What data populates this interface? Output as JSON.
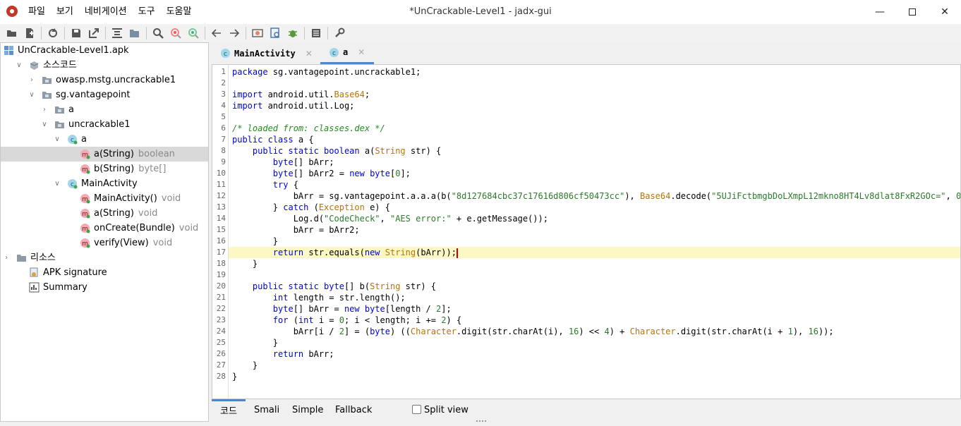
{
  "window": {
    "title": "*UnCrackable-Level1 - jadx-gui",
    "menu": [
      "파일",
      "보기",
      "네비게이션",
      "도구",
      "도움말"
    ]
  },
  "tree": {
    "items": [
      {
        "label": "UnCrackable-Level1.apk",
        "sub": "",
        "depth": 0,
        "icon": "apk-icon",
        "expand": "none",
        "selected": false
      },
      {
        "label": "소스코드",
        "sub": "",
        "depth": 1,
        "icon": "package-box-icon",
        "expand": "open",
        "selected": false
      },
      {
        "label": "owasp.mstg.uncrackable1",
        "sub": "",
        "depth": 2,
        "icon": "package-folder-icon",
        "expand": "closed",
        "selected": false
      },
      {
        "label": "sg.vantagepoint",
        "sub": "",
        "depth": 2,
        "icon": "package-folder-icon",
        "expand": "open",
        "selected": false
      },
      {
        "label": "a",
        "sub": "",
        "depth": 3,
        "icon": "package-folder-icon",
        "expand": "closed",
        "selected": false
      },
      {
        "label": "uncrackable1",
        "sub": "",
        "depth": 3,
        "icon": "package-folder-icon",
        "expand": "open",
        "selected": false
      },
      {
        "label": "a",
        "sub": "",
        "depth": 4,
        "icon": "class-icon",
        "expand": "open",
        "selected": false
      },
      {
        "label": "a(String)",
        "sub": "boolean",
        "depth": 5,
        "icon": "method-icon",
        "expand": "none",
        "selected": true
      },
      {
        "label": "b(String)",
        "sub": "byte[]",
        "depth": 5,
        "icon": "method-icon",
        "expand": "none",
        "selected": false
      },
      {
        "label": "MainActivity",
        "sub": "",
        "depth": 4,
        "icon": "class-icon",
        "expand": "open",
        "selected": false
      },
      {
        "label": "MainActivity()",
        "sub": "void",
        "depth": 5,
        "icon": "method-icon",
        "expand": "none",
        "selected": false
      },
      {
        "label": "a(String)",
        "sub": "void",
        "depth": 5,
        "icon": "method-icon",
        "expand": "none",
        "selected": false
      },
      {
        "label": "onCreate(Bundle)",
        "sub": "void",
        "depth": 5,
        "icon": "method-icon",
        "expand": "none",
        "selected": false
      },
      {
        "label": "verify(View)",
        "sub": "void",
        "depth": 5,
        "icon": "method-icon",
        "expand": "none",
        "selected": false
      },
      {
        "label": "리소스",
        "sub": "",
        "depth": 0,
        "icon": "resources-folder-icon",
        "expand": "closed",
        "selected": false
      },
      {
        "label": "APK signature",
        "sub": "",
        "depth": 1,
        "icon": "certificate-icon",
        "expand": "none",
        "selected": false
      },
      {
        "label": "Summary",
        "sub": "",
        "depth": 1,
        "icon": "summary-icon",
        "expand": "none",
        "selected": false
      }
    ]
  },
  "tabs": [
    {
      "label": "MainActivity",
      "active": false
    },
    {
      "label": "a",
      "active": true
    }
  ],
  "code": {
    "current_line": 17,
    "lines": [
      [
        [
          "kw",
          "package"
        ],
        [
          "t",
          " sg.vantagepoint.uncrackable1;"
        ]
      ],
      [],
      [
        [
          "kw",
          "import"
        ],
        [
          "t",
          " android.util."
        ],
        [
          "ty",
          "Base64"
        ],
        [
          "t",
          ";"
        ]
      ],
      [
        [
          "kw",
          "import"
        ],
        [
          "t",
          " android.util.Log;"
        ]
      ],
      [],
      [
        [
          "cm",
          "/* loaded from: classes.dex */"
        ]
      ],
      [
        [
          "kw",
          "public class"
        ],
        [
          "t",
          " a {"
        ]
      ],
      [
        [
          "t",
          "    "
        ],
        [
          "kw",
          "public static boolean"
        ],
        [
          "t",
          " a("
        ],
        [
          "ty",
          "String"
        ],
        [
          "t",
          " str) {"
        ]
      ],
      [
        [
          "t",
          "        "
        ],
        [
          "kw",
          "byte"
        ],
        [
          "t",
          "[] bArr;"
        ]
      ],
      [
        [
          "t",
          "        "
        ],
        [
          "kw",
          "byte"
        ],
        [
          "t",
          "[] bArr2 = "
        ],
        [
          "kw",
          "new byte"
        ],
        [
          "t",
          "["
        ],
        [
          "nm",
          "0"
        ],
        [
          "t",
          "];"
        ]
      ],
      [
        [
          "t",
          "        "
        ],
        [
          "kw",
          "try"
        ],
        [
          "t",
          " {"
        ]
      ],
      [
        [
          "t",
          "            bArr = sg.vantagepoint.a.a.a(b("
        ],
        [
          "st",
          "\"8d127684cbc37c17616d806cf50473cc\""
        ],
        [
          "t",
          "), "
        ],
        [
          "ty",
          "Base64"
        ],
        [
          "t",
          ".decode("
        ],
        [
          "st",
          "\"5UJiFctbmgbDoLXmpL12mkno8HT4Lv8dlat8FxR2GOc=\""
        ],
        [
          "t",
          ", "
        ],
        [
          "nm",
          "0"
        ],
        [
          "t",
          "));"
        ]
      ],
      [
        [
          "t",
          "        } "
        ],
        [
          "kw",
          "catch"
        ],
        [
          "t",
          " ("
        ],
        [
          "ty",
          "Exception"
        ],
        [
          "t",
          " e) {"
        ]
      ],
      [
        [
          "t",
          "            Log.d("
        ],
        [
          "st",
          "\"CodeCheck\""
        ],
        [
          "t",
          ", "
        ],
        [
          "st",
          "\"AES error:\""
        ],
        [
          "t",
          " + e.getMessage());"
        ]
      ],
      [
        [
          "t",
          "            bArr = bArr2;"
        ]
      ],
      [
        [
          "t",
          "        }"
        ]
      ],
      [
        [
          "t",
          "        "
        ],
        [
          "kw",
          "return"
        ],
        [
          "t",
          " str.equals("
        ],
        [
          "kw",
          "new"
        ],
        [
          "t",
          " "
        ],
        [
          "ty",
          "String"
        ],
        [
          "t",
          "(bArr));"
        ],
        [
          "caret",
          ""
        ]
      ],
      [
        [
          "t",
          "    }"
        ]
      ],
      [],
      [
        [
          "t",
          "    "
        ],
        [
          "kw",
          "public static byte"
        ],
        [
          "t",
          "[] b("
        ],
        [
          "ty",
          "String"
        ],
        [
          "t",
          " str) {"
        ]
      ],
      [
        [
          "t",
          "        "
        ],
        [
          "kw",
          "int"
        ],
        [
          "t",
          " length = str.length();"
        ]
      ],
      [
        [
          "t",
          "        "
        ],
        [
          "kw",
          "byte"
        ],
        [
          "t",
          "[] bArr = "
        ],
        [
          "kw",
          "new byte"
        ],
        [
          "t",
          "[length / "
        ],
        [
          "nm",
          "2"
        ],
        [
          "t",
          "];"
        ]
      ],
      [
        [
          "t",
          "        "
        ],
        [
          "kw",
          "for"
        ],
        [
          "t",
          " ("
        ],
        [
          "kw",
          "int"
        ],
        [
          "t",
          " i = "
        ],
        [
          "nm",
          "0"
        ],
        [
          "t",
          "; i < length; i += "
        ],
        [
          "nm",
          "2"
        ],
        [
          "t",
          ") {"
        ]
      ],
      [
        [
          "t",
          "            bArr[i / "
        ],
        [
          "nm",
          "2"
        ],
        [
          "t",
          "] = ("
        ],
        [
          "kw",
          "byte"
        ],
        [
          "t",
          ") (("
        ],
        [
          "ty",
          "Character"
        ],
        [
          "t",
          ".digit(str.charAt(i), "
        ],
        [
          "nm",
          "16"
        ],
        [
          "t",
          ") << "
        ],
        [
          "nm",
          "4"
        ],
        [
          "t",
          ") + "
        ],
        [
          "ty",
          "Character"
        ],
        [
          "t",
          ".digit(str.charAt(i + "
        ],
        [
          "nm",
          "1"
        ],
        [
          "t",
          "), "
        ],
        [
          "nm",
          "16"
        ],
        [
          "t",
          "));"
        ]
      ],
      [
        [
          "t",
          "        }"
        ]
      ],
      [
        [
          "t",
          "        "
        ],
        [
          "kw",
          "return"
        ],
        [
          "t",
          " bArr;"
        ]
      ],
      [
        [
          "t",
          "    }"
        ]
      ],
      [
        [
          "t",
          "}"
        ]
      ]
    ]
  },
  "bottom_tabs": [
    {
      "label": "코드",
      "active": true
    },
    {
      "label": "Smali",
      "active": false
    },
    {
      "label": "Simple",
      "active": false
    },
    {
      "label": "Fallback",
      "active": false
    }
  ],
  "split_view": {
    "label": "Split view",
    "checked": false
  }
}
